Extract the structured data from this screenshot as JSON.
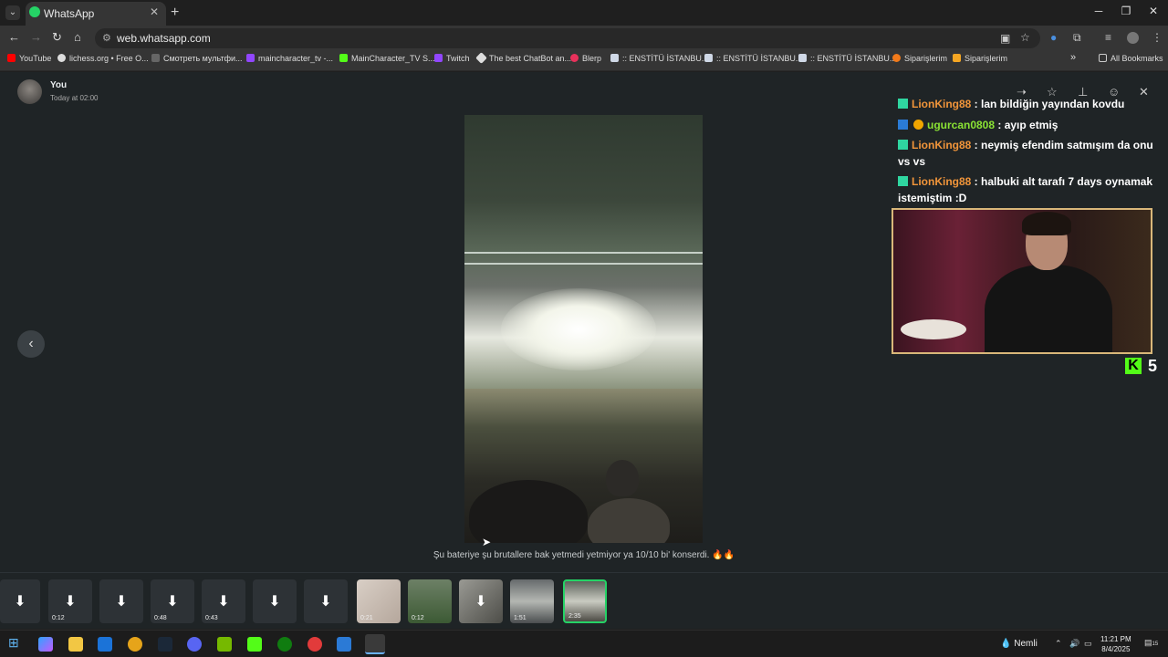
{
  "browser": {
    "tab_title": "WhatsApp",
    "url": "web.whatsapp.com",
    "bookmarks": [
      {
        "label": "YouTube",
        "color": "#ff0000"
      },
      {
        "label": "lichess.org • Free O...",
        "color": "#dddddd"
      },
      {
        "label": "Смотреть мультфи...",
        "color": "#666666"
      },
      {
        "label": "maincharacter_tv -...",
        "color": "#9146ff"
      },
      {
        "label": "MainCharacter_TV S...",
        "color": "#53fc18"
      },
      {
        "label": "Twitch",
        "color": "#9146ff"
      },
      {
        "label": "The best ChatBot an...",
        "color": "#dddddd"
      },
      {
        "label": "Blerp",
        "color": "#e8315b"
      },
      {
        "label": ":: ENSTİTÜ İSTANBU...",
        "color": "#cfd8e6"
      },
      {
        "label": ":: ENSTİTÜ İSTANBU...",
        "color": "#cfd8e6"
      },
      {
        "label": ":: ENSTİTÜ İSTANBU...",
        "color": "#cfd8e6"
      },
      {
        "label": "Siparişlerim",
        "color": "#f27a1a"
      },
      {
        "label": "Siparişlerim",
        "color": "#f5a623"
      }
    ],
    "all_bookmarks": "All Bookmarks"
  },
  "viewer": {
    "sender": "You",
    "sent_time": "Today at 02:00",
    "caption": "Şu bateriye şu brutallere bak yetmedi yetmiyor ya 10/10 bi' konserdi. 🔥🔥"
  },
  "stream_overlay": {
    "chat": [
      {
        "user": "LionKing88",
        "color": "orange",
        "text": " : lan bildiğin yayından kovdu"
      },
      {
        "user": "ugurcan0808",
        "color": "green",
        "text": " : ayıp etmiş"
      },
      {
        "user": "LionKing88",
        "color": "orange",
        "text": " : neymiş efendim satmışım da onu vs vs"
      },
      {
        "user": "LionKing88",
        "color": "orange",
        "text": " : halbuki alt tarafı 7 days oynamak istemiştim :D"
      }
    ],
    "kick_logo": "K",
    "viewer_count": "5"
  },
  "thumbnails": [
    {
      "type": "download",
      "duration": ""
    },
    {
      "type": "download",
      "duration": "0:12"
    },
    {
      "type": "download",
      "duration": ""
    },
    {
      "type": "download",
      "duration": "0:48"
    },
    {
      "type": "download",
      "duration": "0:43"
    },
    {
      "type": "download",
      "duration": ""
    },
    {
      "type": "download",
      "duration": ""
    },
    {
      "type": "image",
      "duration": "0:21"
    },
    {
      "type": "image",
      "duration": "0:12"
    },
    {
      "type": "download-image",
      "duration": ""
    },
    {
      "type": "image",
      "duration": "1:51"
    },
    {
      "type": "selected",
      "duration": "2:35"
    }
  ],
  "taskbar": {
    "weather": "Nemli",
    "time": "11:21 PM",
    "date": "8/4/2025",
    "notif_count": "15"
  }
}
